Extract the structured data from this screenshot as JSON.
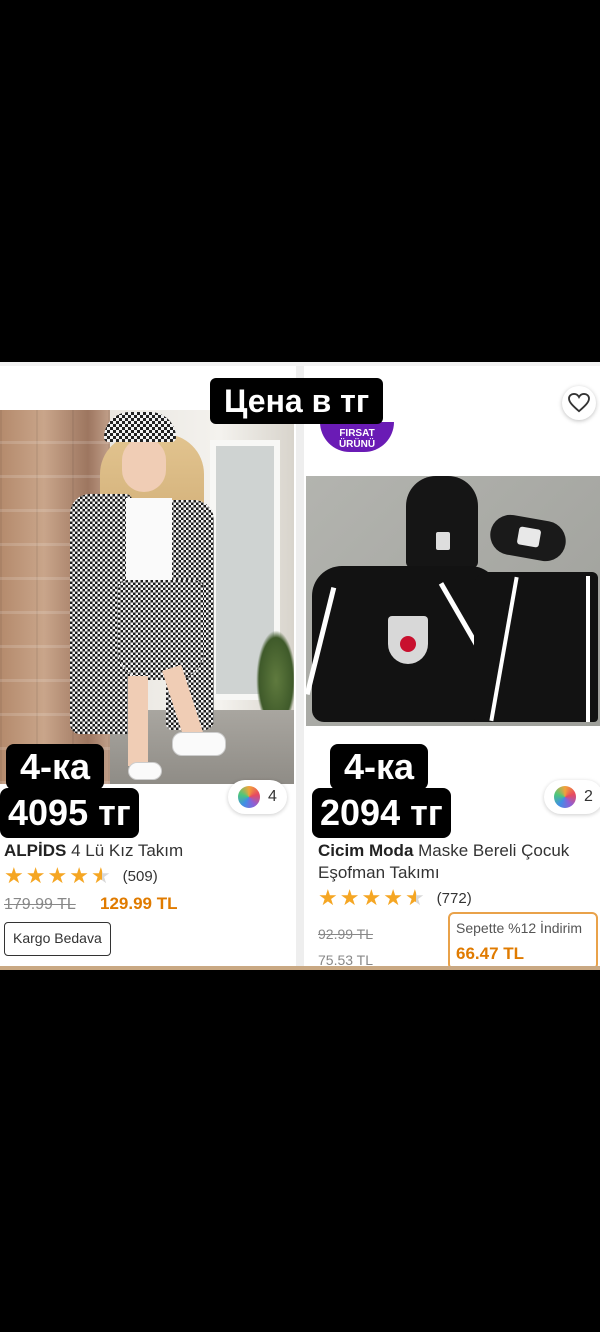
{
  "overlay": {
    "title": "Цена в тг"
  },
  "left_product": {
    "overlay_line1": "4-ка",
    "overlay_line2": "4095 тг",
    "color_count": "4",
    "brand": "ALPİDS",
    "name": " 4 Lü Kız Takım",
    "rating": 4.5,
    "rating_count": "(509)",
    "price_old": "179.99 TL",
    "price_new": "129.99 TL",
    "badge": "Kargo Bedava"
  },
  "right_product": {
    "badge": "FIRSAT ÜRÜNÜ",
    "overlay_line1": "4-ка",
    "overlay_line2": "2094 тг",
    "color_count": "2",
    "brand": "Cicim Moda",
    "name": " Maske Bereli Çocuk Eşofman Takımı",
    "rating": 4.5,
    "rating_count": "(772)",
    "price_old": "92.99 TL",
    "price_current": "75.53 TL",
    "basket_label": "Sepette %12 İndirim",
    "basket_price": "66.47 TL"
  },
  "icons": {
    "favorite": "heart-icon",
    "colors": "color-palette-icon",
    "rating": "star-icon"
  },
  "colors": {
    "accent_orange": "#e07b00",
    "star": "#f5a623",
    "badge_purple": "#6a1bb5",
    "basket_border": "#e9a24a"
  }
}
